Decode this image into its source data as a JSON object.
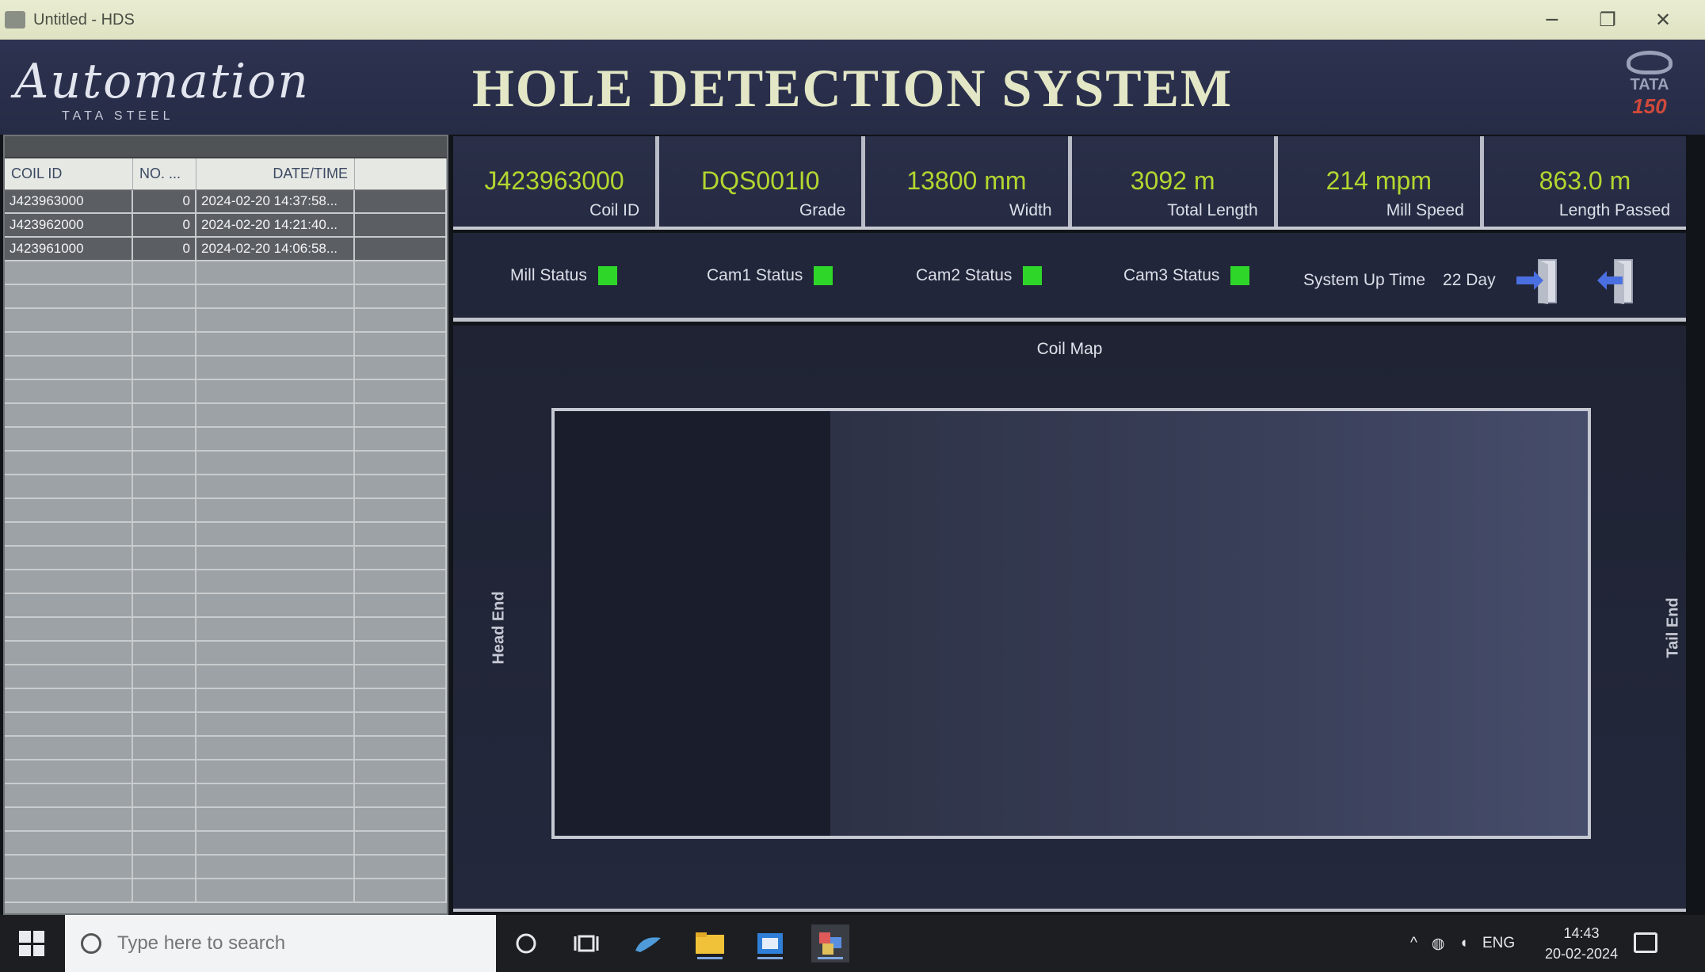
{
  "window": {
    "title": "Untitled - HDS",
    "minimize": "─",
    "restore": "❐",
    "close": "✕"
  },
  "header": {
    "logo_left_script": "Automation",
    "logo_left_sub": "TATA STEEL",
    "title": "HOLE DETECTION SYSTEM",
    "logo_right_name": "TATA",
    "logo_right_year": "150"
  },
  "coil_table": {
    "columns": [
      "COIL ID",
      "NO. ...",
      "DATE/TIME",
      ""
    ],
    "rows": [
      {
        "coil_id": "J423963000",
        "no": "0",
        "datetime": "2024-02-20 14:37:58..."
      },
      {
        "coil_id": "J423962000",
        "no": "0",
        "datetime": "2024-02-20 14:21:40..."
      },
      {
        "coil_id": "J423961000",
        "no": "0",
        "datetime": "2024-02-20 14:06:58..."
      }
    ]
  },
  "info": {
    "coil_id": {
      "value": "J423963000",
      "label": "Coil ID"
    },
    "grade": {
      "value": "DQS001I0",
      "label": "Grade"
    },
    "width": {
      "value": "13800 mm",
      "label": "Width"
    },
    "total_length": {
      "value": "3092 m",
      "label": "Total Length"
    },
    "mill_speed": {
      "value": "214 mpm",
      "label": "Mill Speed"
    },
    "length_passed": {
      "value": "863.0 m",
      "label": "Length Passed"
    }
  },
  "status": {
    "mill": "Mill Status",
    "cam1": "Cam1 Status",
    "cam2": "Cam2 Status",
    "cam3": "Cam3 Status",
    "uptime_label": "System Up Time",
    "uptime_value": "22 Day",
    "led_color": "#2fd62a"
  },
  "coil_map": {
    "title": "Coil Map",
    "head_end": "Head End",
    "tail_end": "Tail End"
  },
  "taskbar": {
    "search_placeholder": "Type here to search",
    "language": "ENG",
    "time": "14:43",
    "date": "20-02-2024"
  }
}
